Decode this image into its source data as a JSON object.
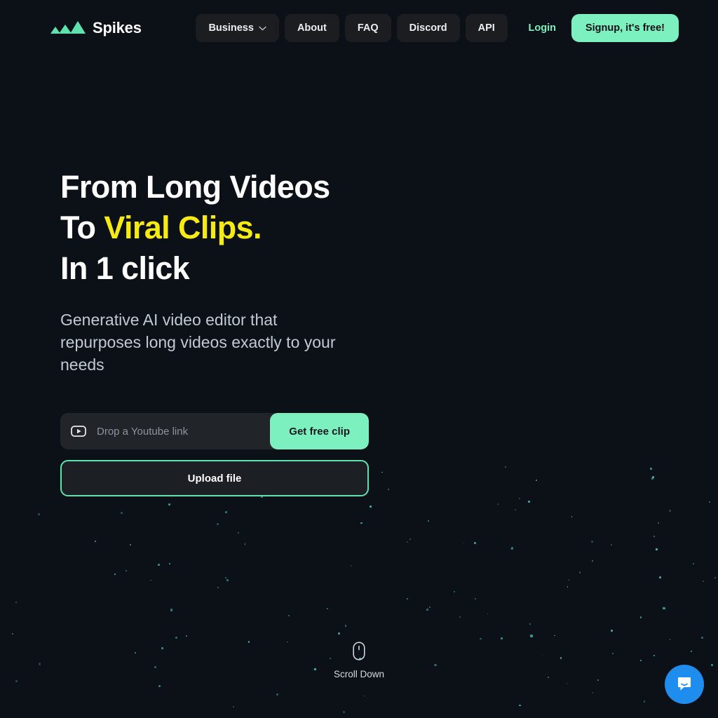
{
  "brand": {
    "name": "Spikes",
    "logo_icon": "spikes-logo-icon",
    "accent_mint": "#7df0c0",
    "accent_yellow": "#f5ea12",
    "background": "#0c1118"
  },
  "nav": {
    "items": [
      {
        "label": "Business",
        "has_dropdown": true,
        "icon": "chevron-down-icon"
      },
      {
        "label": "About",
        "has_dropdown": false
      },
      {
        "label": "FAQ",
        "has_dropdown": false
      },
      {
        "label": "Discord",
        "has_dropdown": false
      },
      {
        "label": "API",
        "has_dropdown": false
      }
    ],
    "login_label": "Login",
    "signup_label": "Signup, it's free!"
  },
  "hero": {
    "headline_line1": "From Long Videos",
    "headline_line2_prefix": "To ",
    "headline_line2_accent": "Viral Clips.",
    "headline_line3": "In 1 click",
    "subhead": "Generative AI video editor that repurposes long videos exactly to your needs"
  },
  "link_form": {
    "icon": "youtube-icon",
    "placeholder": "Drop a Youtube link",
    "value": "",
    "submit_label": "Get free clip",
    "upload_label": "Upload file"
  },
  "scroll": {
    "icon": "mouse-icon",
    "label": "Scroll Down"
  },
  "chat": {
    "icon": "chat-bubble-icon",
    "color": "#1f8ded"
  }
}
